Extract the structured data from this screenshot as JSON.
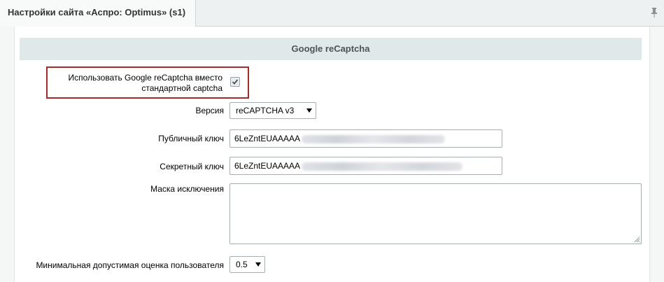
{
  "tab": {
    "title": "Настройки сайта «Аспро: Optimus» (s1)"
  },
  "section": {
    "title": "Google reCaptcha"
  },
  "fields": {
    "use_recaptcha": {
      "label_line1": "Использовать Google reCaptcha вместо",
      "label_line2": "стандартной captcha",
      "checked": true
    },
    "version": {
      "label": "Версия",
      "value": "reCAPTCHA v3"
    },
    "public_key": {
      "label": "Публичный ключ",
      "value": "6LeZntEUAAAAA"
    },
    "secret_key": {
      "label": "Секретный ключ",
      "value": "6LeZntEUAAAAA"
    },
    "exclusion_mask": {
      "label": "Маска исключения",
      "value": ""
    },
    "min_score": {
      "label": "Минимальная допустимая оценка пользователя",
      "value": "0.5"
    }
  },
  "colors": {
    "highlight_border": "#a52a2a",
    "section_header_bg": "#e0e8ea"
  }
}
